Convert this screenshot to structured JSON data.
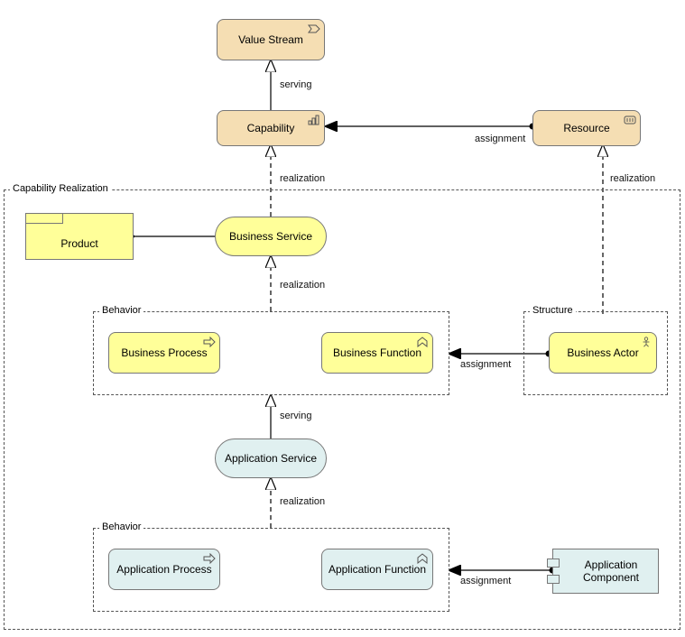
{
  "nodes": {
    "valueStream": "Value Stream",
    "capability": "Capability",
    "resource": "Resource",
    "product": "Product",
    "businessService": "Business Service",
    "businessProcess": "Business Process",
    "businessFunction": "Business Function",
    "businessActor": "Business Actor",
    "applicationService": "Application Service",
    "applicationProcess": "Application Process",
    "applicationFunction": "Application Function",
    "applicationComponent": "Application Component"
  },
  "groups": {
    "capabilityRealization": "Capability Realization",
    "behavior1": "Behavior",
    "structure": "Structure",
    "behavior2": "Behavior"
  },
  "edges": {
    "serving1": "serving",
    "realization1": "realization",
    "assignment1": "assignment",
    "realization2": "realization",
    "realization3": "realization",
    "assignment2": "assignment",
    "serving2": "serving",
    "realization4": "realization",
    "assignment3": "assignment"
  }
}
